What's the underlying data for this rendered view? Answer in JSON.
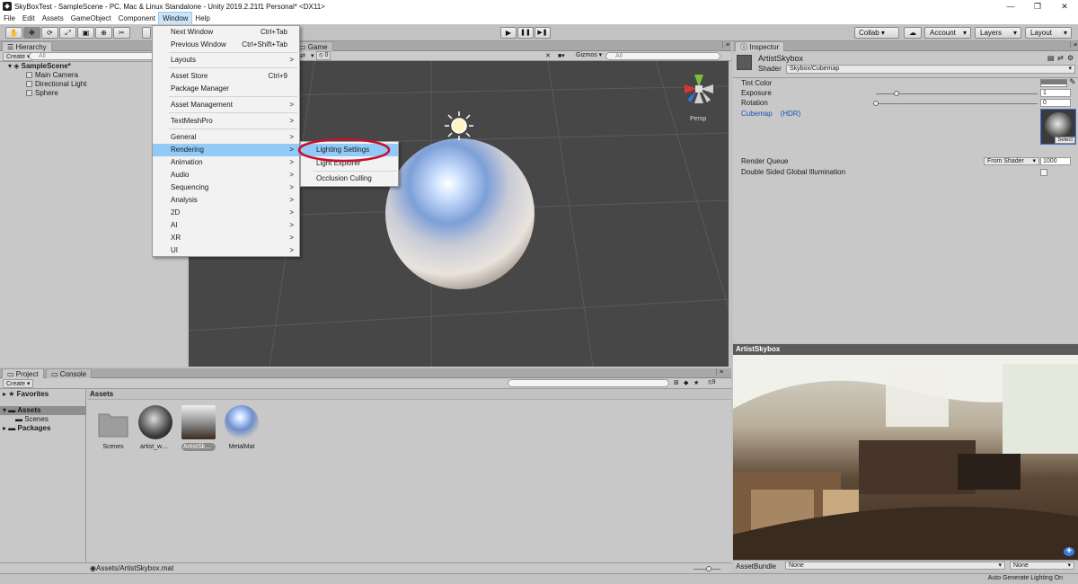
{
  "window": {
    "title": "SkyBoxTest - SampleScene - PC, Mac & Linux Standalone - Unity 2019.2.21f1 Personal* <DX11>",
    "controls": {
      "minimize": "—",
      "maximize": "❐",
      "close": "✕"
    }
  },
  "menubar": {
    "items": [
      "File",
      "Edit",
      "Assets",
      "GameObject",
      "Component",
      "Window",
      "Help"
    ],
    "active": "Window"
  },
  "toolbar": {
    "tools": [
      "hand-tool-icon",
      "move-tool-icon",
      "rotate-tool-icon",
      "scale-tool-icon",
      "rect-tool-icon",
      "transform-tool-icon",
      "custom-tool-icon"
    ],
    "play": "▶",
    "pause": "❚❚",
    "step": "▶❚",
    "collab": "Collab ▾",
    "account": "Account",
    "layers": "Layers",
    "layout": "Layout"
  },
  "hierarchy": {
    "tab": "Hierarchy",
    "create": "Create ▾",
    "search_placeholder": "All",
    "scene": "SampleScene*",
    "objects": [
      "Main Camera",
      "Directional Light",
      "Sphere"
    ]
  },
  "game_tab": "Game",
  "scene_view": {
    "toolbar_count": "0",
    "gizmos": "Gizmos ▾",
    "search_placeholder": "All",
    "persp": "Persp"
  },
  "window_menu": {
    "items": [
      {
        "label": "Next Window",
        "shortcut": "Ctrl+Tab"
      },
      {
        "label": "Previous Window",
        "shortcut": "Ctrl+Shift+Tab"
      },
      {
        "label": "Layouts",
        "arrow": ">"
      },
      {
        "label": "Asset Store",
        "shortcut": "Ctrl+9"
      },
      {
        "label": "Package Manager"
      },
      {
        "label": "Asset Management",
        "arrow": ">"
      },
      {
        "label": "TextMeshPro",
        "arrow": ">"
      },
      {
        "label": "General",
        "arrow": ">"
      },
      {
        "label": "Rendering",
        "arrow": ">",
        "highlighted": true
      },
      {
        "label": "Animation",
        "arrow": ">"
      },
      {
        "label": "Audio",
        "arrow": ">"
      },
      {
        "label": "Sequencing",
        "arrow": ">"
      },
      {
        "label": "Analysis",
        "arrow": ">"
      },
      {
        "label": "2D",
        "arrow": ">"
      },
      {
        "label": "AI",
        "arrow": ">"
      },
      {
        "label": "XR",
        "arrow": ">"
      },
      {
        "label": "UI",
        "arrow": ">"
      }
    ]
  },
  "rendering_submenu": {
    "items": [
      "Lighting Settings",
      "Light Explorer",
      "Occlusion Culling"
    ],
    "circled": "Lighting Settings",
    "circle_color": "#c8102e"
  },
  "inspector": {
    "tab": "Inspector",
    "material_name": "ArtistSkybox",
    "shader_label": "Shader",
    "shader_value": "Skybox/Cubemap",
    "tint_label": "Tint Color",
    "exposure_label": "Exposure",
    "exposure_value": "1",
    "exposure_fraction": 0.125,
    "rotation_label": "Rotation",
    "rotation_value": "0",
    "rotation_fraction": 0,
    "cubemap_label": "Cubemap",
    "cubemap_hdr": "(HDR)",
    "select_label": "Select",
    "render_queue_label": "Render Queue",
    "render_queue_mode": "From Shader",
    "render_queue_value": "1000",
    "double_sided_label": "Double Sided Global Illumination"
  },
  "preview": {
    "title": "ArtistSkybox",
    "assetbundle_label": "AssetBundle",
    "assetbundle_value": "None",
    "assetbundle_variant": "None"
  },
  "project": {
    "tab_project": "Project",
    "tab_console": "Console",
    "create": "Create ▾",
    "search_placeholder": "",
    "count": "9",
    "favorites": "Favorites",
    "tree": [
      "Assets",
      "Scenes",
      "Packages"
    ],
    "breadcrumb": "Assets",
    "assets": [
      {
        "name": "Scenes",
        "kind": "folder"
      },
      {
        "name": "artist_work...",
        "kind": "hdr"
      },
      {
        "name": "ArtistSkyb...",
        "kind": "cubemap",
        "selected": true
      },
      {
        "name": "MetalMat",
        "kind": "material"
      }
    ],
    "path": "Assets/ArtistSkybox.mat"
  },
  "status": {
    "text": "Auto Generate Lighting On"
  }
}
